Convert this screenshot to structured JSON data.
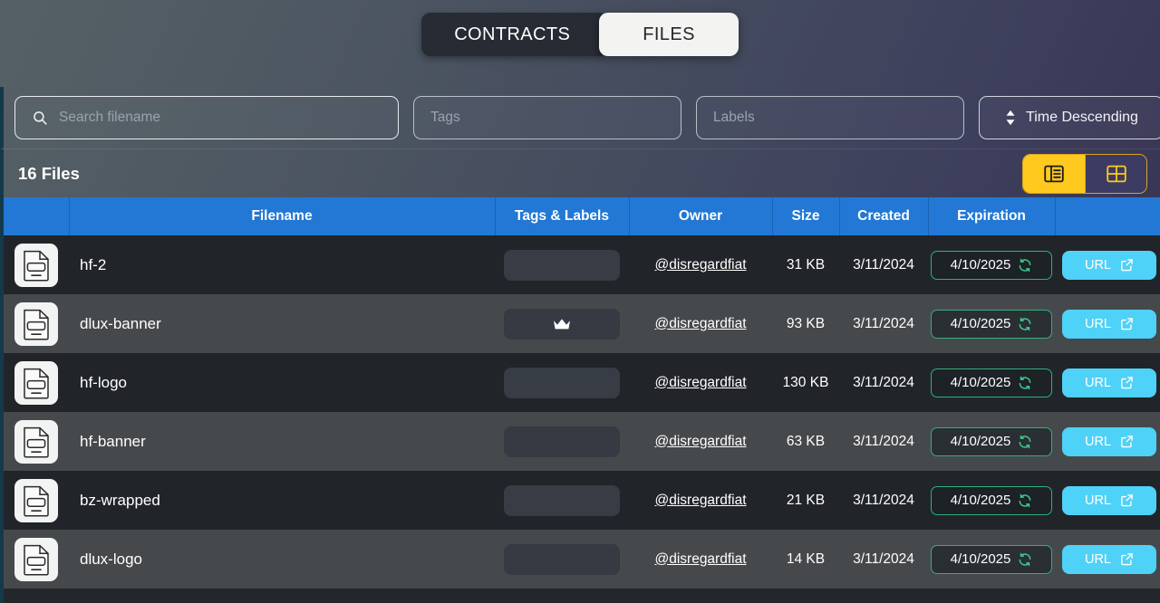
{
  "tabs": [
    {
      "label": "CONTRACTS",
      "active": false
    },
    {
      "label": "FILES",
      "active": true
    }
  ],
  "filters": {
    "search_placeholder": "Search filename",
    "search_value": "",
    "tags_placeholder": "Tags",
    "tags_value": "",
    "labels_placeholder": "Labels",
    "labels_value": "",
    "sort_value": "Time Descending"
  },
  "toolbar": {
    "count_label": "16 Files",
    "view_list_active": true,
    "view_grid_active": false
  },
  "table": {
    "columns": [
      "",
      "Filename",
      "Tags & Labels",
      "Owner",
      "Size",
      "Created",
      "Expiration",
      ""
    ],
    "rows": [
      {
        "type": "PNG",
        "filename": "hf-2",
        "badge": "",
        "owner": "@disregardfiat",
        "size": "31 KB",
        "created": "3/11/2024",
        "expiration": "4/10/2025",
        "action": "URL"
      },
      {
        "type": "PNG",
        "filename": "dlux-banner",
        "badge": "crown",
        "owner": "@disregardfiat",
        "size": "93 KB",
        "created": "3/11/2024",
        "expiration": "4/10/2025",
        "action": "URL"
      },
      {
        "type": "PNG",
        "filename": "hf-logo",
        "badge": "",
        "owner": "@disregardfiat",
        "size": "130 KB",
        "created": "3/11/2024",
        "expiration": "4/10/2025",
        "action": "URL"
      },
      {
        "type": "PNG",
        "filename": "hf-banner",
        "badge": "",
        "owner": "@disregardfiat",
        "size": "63 KB",
        "created": "3/11/2024",
        "expiration": "4/10/2025",
        "action": "URL"
      },
      {
        "type": "PNG",
        "filename": "bz-wrapped",
        "badge": "",
        "owner": "@disregardfiat",
        "size": "21 KB",
        "created": "3/11/2024",
        "expiration": "4/10/2025",
        "action": "URL"
      },
      {
        "type": "PNG",
        "filename": "dlux-logo",
        "badge": "",
        "owner": "@disregardfiat",
        "size": "14 KB",
        "created": "3/11/2024",
        "expiration": "4/10/2025",
        "action": "URL"
      }
    ]
  },
  "colors": {
    "header_blue": "#2278d4",
    "accent_yellow": "#ffc91d",
    "url_blue": "#4fd2f7",
    "expiration_green": "#2fb07a",
    "row_odd": "#212529",
    "row_even": "#46494c"
  }
}
